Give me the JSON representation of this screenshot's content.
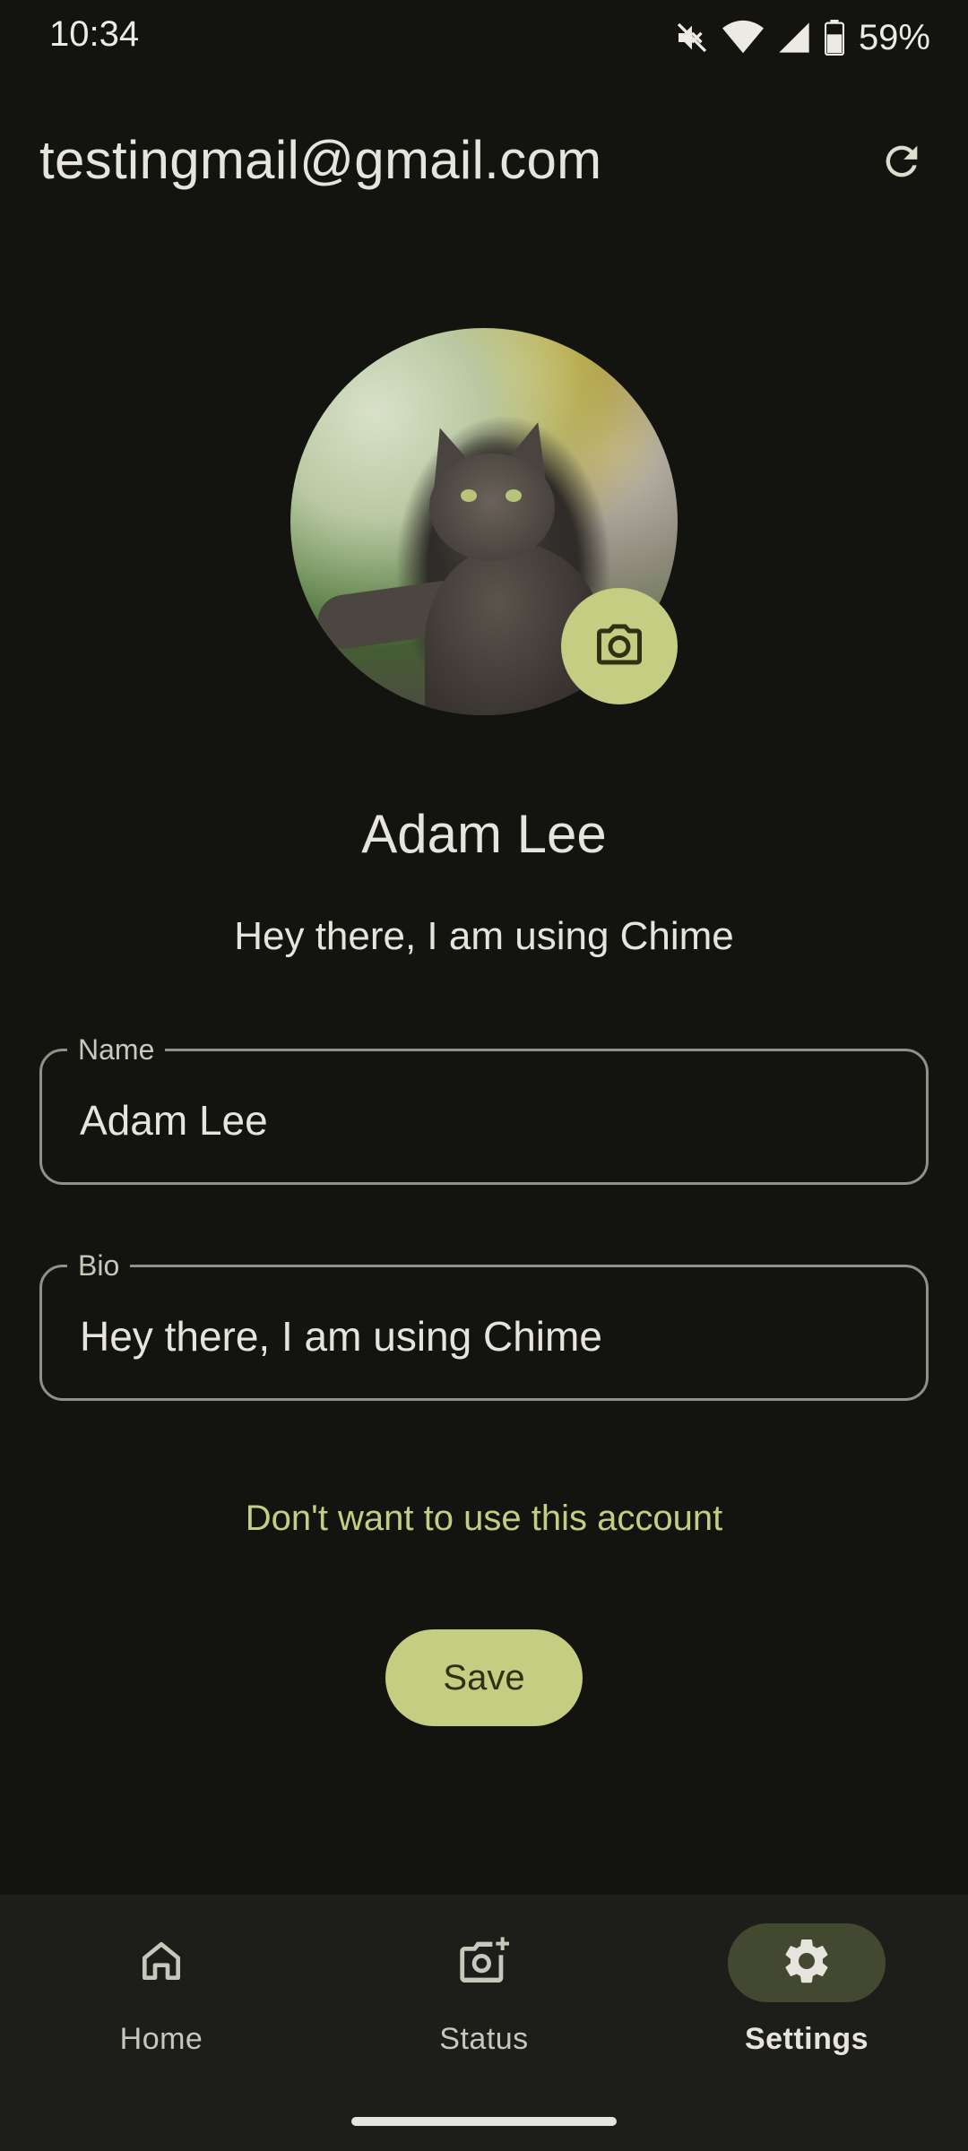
{
  "status_bar": {
    "time": "10:34",
    "battery_percent": "59%",
    "icons": [
      "mute-icon",
      "wifi-icon",
      "signal-icon",
      "battery-icon"
    ]
  },
  "header": {
    "account_email": "testingmail@gmail.com",
    "refresh_icon": "refresh-icon"
  },
  "profile": {
    "display_name": "Adam Lee",
    "display_bio": "Hey there, I am using Chime",
    "avatar_description": "cat-photo",
    "camera_icon": "camera-icon"
  },
  "form": {
    "name_label": "Name",
    "name_value": "Adam Lee",
    "bio_label": "Bio",
    "bio_value": "Hey there, I am using Chime"
  },
  "actions": {
    "switch_account_link": "Don't want to use this account",
    "save_label": "Save"
  },
  "bottom_nav": {
    "items": [
      {
        "label": "Home",
        "icon": "home-icon",
        "selected": false
      },
      {
        "label": "Status",
        "icon": "add-photo-icon",
        "selected": false
      },
      {
        "label": "Settings",
        "icon": "gear-icon",
        "selected": true
      }
    ]
  },
  "colors": {
    "background": "#131410",
    "accent": "#c5cd83",
    "nav_background": "#1d1e19",
    "selected_pill": "#434830",
    "outline": "#8f9187"
  }
}
